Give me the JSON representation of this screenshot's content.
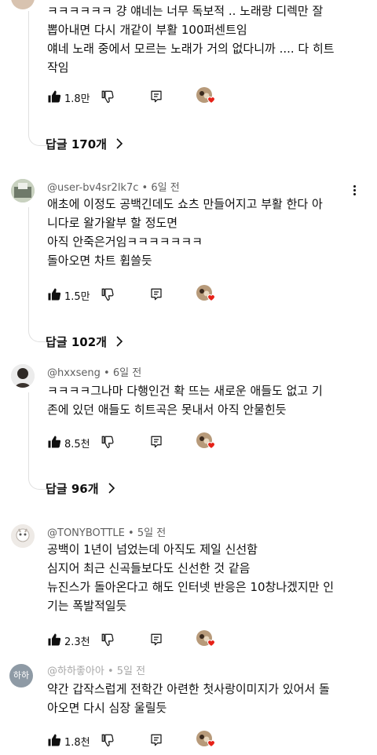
{
  "comments": [
    {
      "author": "",
      "time": "",
      "lines": [
        "ㅋㅋㅋㅋㅋㅋ 걍 얘네는 너무 독보적 .. 노래랑 디렉만 잘",
        "뽑아내면 다시 개같이 부활 100퍼센트임",
        "얘네 노래 중에서 모르는 노래가 거의 없다니까 .... 다 히트",
        "작임"
      ],
      "likes": "1.8만",
      "replies": "답글 170개"
    },
    {
      "author": "@user-bv4sr2lk7c",
      "time": "6일 전",
      "lines": [
        "애초에 이정도 공백긴데도 쇼츠 만들어지고 부활 한다 아",
        "니다로 왈가왈부 할 정도면",
        "아직 안죽은거임ㅋㅋㅋㅋㅋㅋㅋ",
        "돌아오면 차트 휩쓸듯"
      ],
      "likes": "1.5만",
      "replies": "답글 102개"
    },
    {
      "author": "@hxxseng",
      "time": "6일 전",
      "lines": [
        "ㅋㅋㅋㅋ그나마 다행인건 확 뜨는 새로운 애들도 없고 기",
        "존에 있던 애들도 히트곡은 못내서 아직 안물힌듯"
      ],
      "likes": "8.5천",
      "replies": "답글 96개"
    },
    {
      "author": "@TONYBOTTLE",
      "time": "5일 전",
      "lines": [
        "공백이 1년이 넘었는데 아직도 제일 신선함",
        "심지어 최근 신곡들보다도 신선한 것 같음",
        "뉴진스가 돌아온다고 해도 인터넷 반응은 10창나겠지만 인",
        "기는 폭발적일듯"
      ],
      "likes": "2.3천",
      "replies": ""
    },
    {
      "author": "@하하좋아아",
      "time": "5일 전",
      "avatar_text": "하하",
      "lines": [
        "약간 갑작스럽게 전학간 아련한 첫사랑이미지가 있어서 돌",
        "아오면 다시 심장 울릴듯"
      ],
      "likes": "1.8천",
      "replies": ""
    }
  ],
  "icons": {
    "like": "thumbs-up-icon",
    "dislike": "thumbs-down-icon",
    "reply": "reply-icon",
    "creator_heart": "creator-heart-icon",
    "more": "more-vert-icon",
    "chevron": "chevron-right-icon"
  },
  "colors": {
    "heart": "#e62117",
    "meta": "#606060",
    "text": "#0f0f0f"
  }
}
